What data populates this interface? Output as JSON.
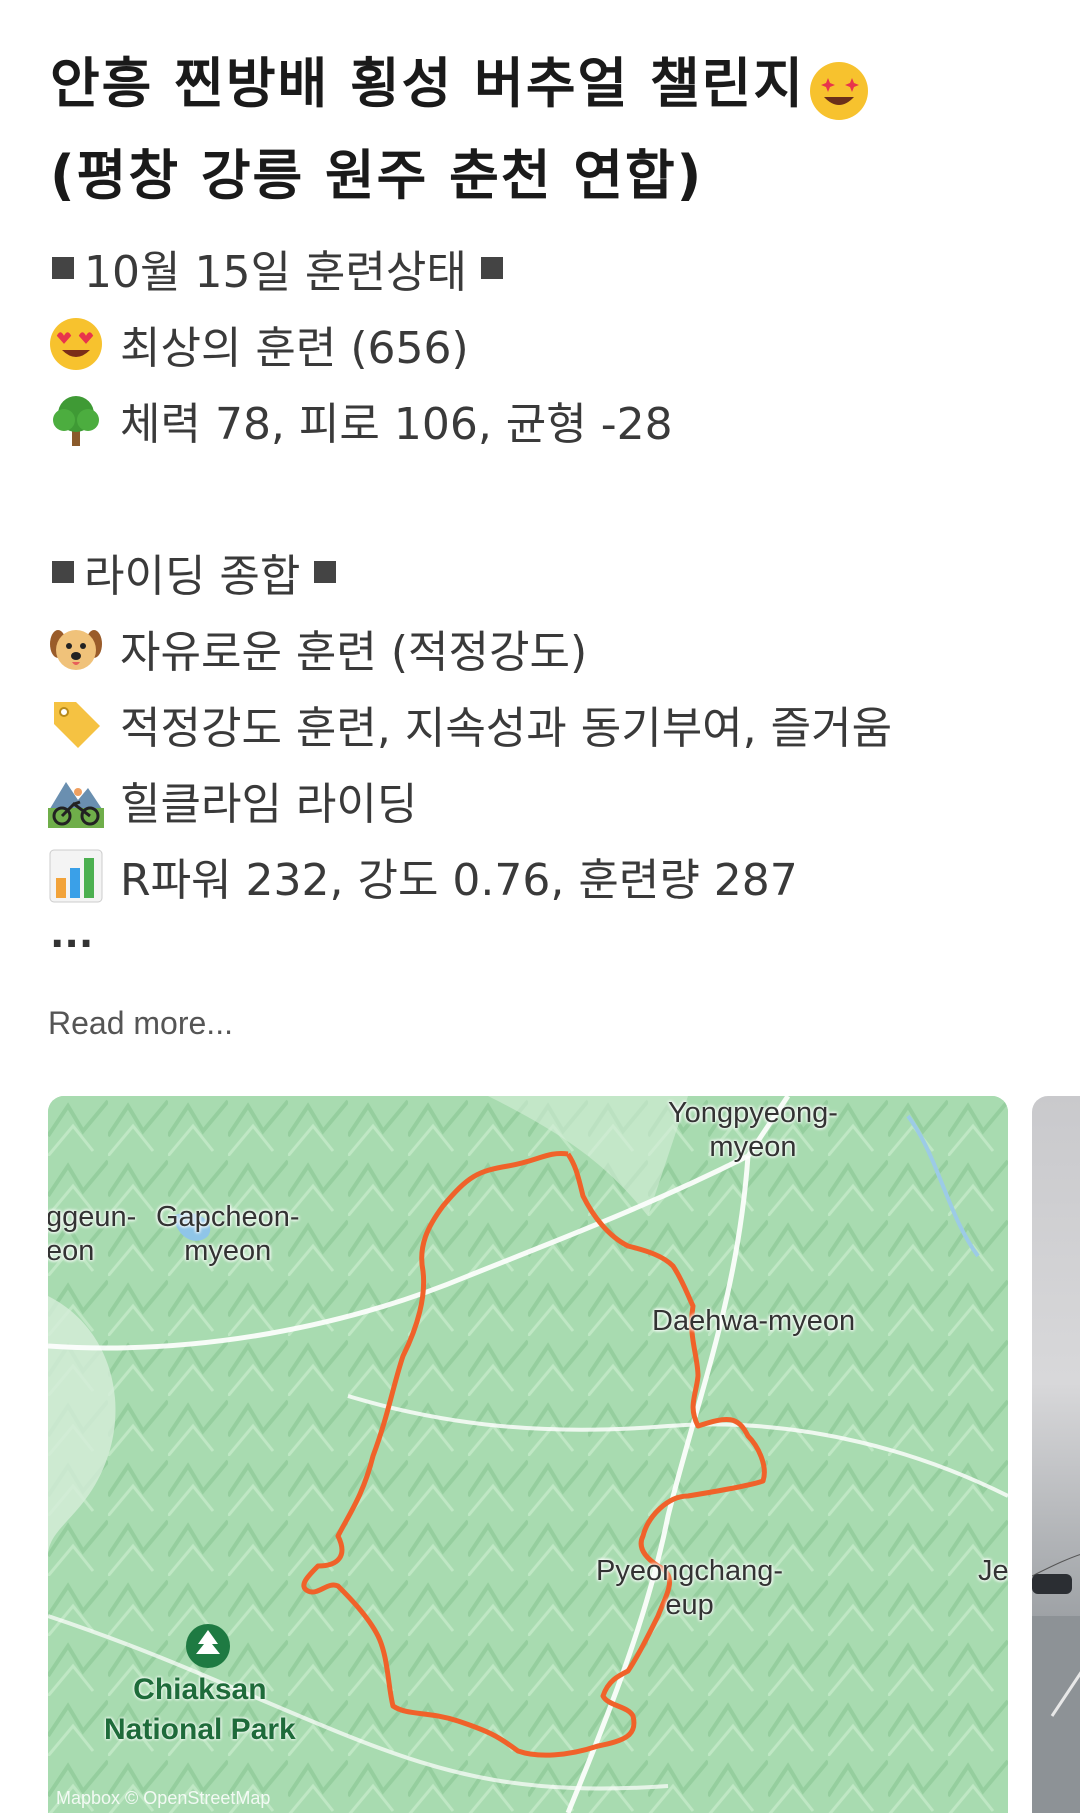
{
  "post": {
    "title_line1": "안흥 찐방배 횡성 버추얼 챌린지",
    "title_emoji": "star-struck-emoji",
    "title_line2": "(평창 강릉 원주 춘천 연합)"
  },
  "status": {
    "header": "10월 15일 훈련상태",
    "condition_text": "최상의 훈련 (656)",
    "condition_icon": "heart-eyes-emoji",
    "metrics_text": "체력 78, 피로 106, 균형 -28",
    "metrics_icon": "tree-emoji"
  },
  "summary": {
    "header": "라이딩 종합",
    "type_text": "자유로운 훈련 (적정강도)",
    "type_icon": "dog-emoji",
    "tags_text": "적정강도 훈련, 지속성과 동기부여, 즐거움",
    "tags_icon": "tag-emoji",
    "ride_text": "힐클라임 라이딩",
    "ride_icon": "mountain-bike-emoji",
    "power_text": "R파워 232, 강도 0.76, 훈련량 287",
    "power_icon": "bar-chart-emoji"
  },
  "ellipsis": "...",
  "read_more": "Read more...",
  "map": {
    "labels": {
      "yongpyeong": "Yongpyeong-\nmyeon",
      "gapcheon": "Gapcheon-\nmyeon",
      "left_partial": "ggeun-\neon",
      "daehwa": "Daehwa-myeon",
      "pyeongchang": "Pyeongchang-\neup",
      "right_partial": "Je",
      "park": "Chiaksan\nNational Park"
    },
    "attribution": "Mapbox © OpenStreetMap",
    "route_color": "#f0622a"
  }
}
